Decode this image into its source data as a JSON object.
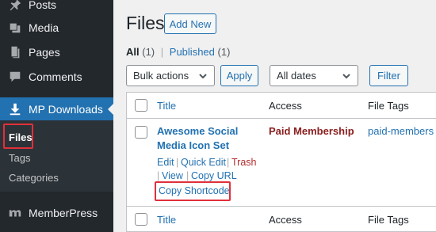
{
  "sidebar": {
    "items": [
      {
        "label": "Posts",
        "icon": "pushpin-icon"
      },
      {
        "label": "Media",
        "icon": "media-icon"
      },
      {
        "label": "Pages",
        "icon": "pages-icon"
      },
      {
        "label": "Comments",
        "icon": "comment-icon"
      },
      {
        "label": "MP Downloads",
        "icon": "download-icon"
      },
      {
        "label": "MemberPress",
        "icon": "memberpress-icon"
      }
    ],
    "submenu": [
      "Files",
      "Tags",
      "Categories"
    ]
  },
  "header": {
    "title": "Files",
    "add_new": "Add New"
  },
  "views": {
    "all": "All",
    "all_count": "(1)",
    "separator": "|",
    "published": "Published",
    "published_count": "(1)"
  },
  "filters": {
    "bulk_actions": "Bulk actions",
    "apply": "Apply",
    "dates": "All dates",
    "filter": "Filter"
  },
  "table": {
    "columns": [
      "Title",
      "Access",
      "File Tags"
    ],
    "rows": [
      {
        "title_line1": "Awesome Social",
        "title_line2": "Media Icon Set",
        "access": "Paid Membership",
        "tags": "paid-members",
        "actions": {
          "edit": "Edit",
          "quick_edit": "Quick Edit",
          "trash": "Trash",
          "view": "View",
          "copy_url": "Copy URL",
          "copy_shortcode": "Copy Shortcode"
        }
      }
    ]
  },
  "colors": {
    "sidebar": "#23282d",
    "active": "#2271b1",
    "link": "#2271b1",
    "access": "#8a1d1d",
    "highlight": "#e0303b"
  }
}
